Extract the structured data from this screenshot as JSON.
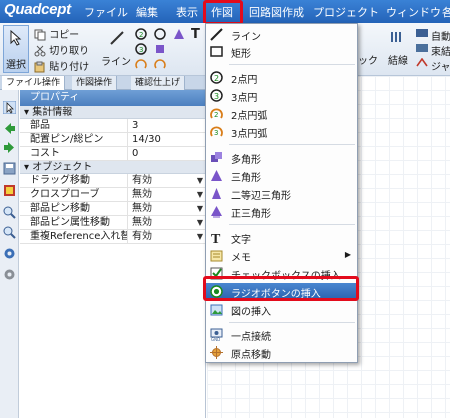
{
  "app": {
    "logo": "Quadcept"
  },
  "menubar": {
    "items": [
      "ファイル",
      "編集",
      "表示",
      "作図",
      "回路図作成",
      "プロジェクト",
      "ウィンドウ",
      "各"
    ],
    "active_index": 3
  },
  "ribbon": {
    "select_label": "選択",
    "copy_label": "コピー",
    "cut_label": "切り取り",
    "paste_label": "貼り付け",
    "line_label": "ライン",
    "right_fragment": "ック",
    "wiring_label": "結線",
    "auto_label": "自動",
    "bundle_label": "束結",
    "jump_label": "ジャ"
  },
  "tabs": [
    {
      "label": "ファイル操作"
    },
    {
      "label": "作図操作"
    },
    {
      "label": "確認仕上げ"
    }
  ],
  "property_panel": {
    "title": "プロパティ",
    "sections": [
      {
        "title": "集計情報",
        "rows": [
          {
            "key": "部品",
            "value": "3"
          },
          {
            "key": "配置ピン/総ピン",
            "value": "14/30"
          },
          {
            "key": "コスト",
            "value": "0"
          }
        ]
      },
      {
        "title": "オブジェクト",
        "rows": [
          {
            "key": "ドラッグ移動",
            "value": "有効"
          },
          {
            "key": "クロスプローブ",
            "value": "無効"
          },
          {
            "key": "部品ピン移動",
            "value": "無効"
          },
          {
            "key": "部品ピン属性移動",
            "value": "無効"
          },
          {
            "key": "重複Reference入れ替え",
            "value": "有効"
          }
        ]
      }
    ]
  },
  "dropdown": {
    "items": [
      {
        "label": "ライン",
        "icon": "line-icon"
      },
      {
        "label": "矩形",
        "icon": "rectangle-icon"
      },
      {
        "label": "2点円",
        "icon": "circle-2pt-icon"
      },
      {
        "label": "3点円",
        "icon": "circle-3pt-icon"
      },
      {
        "label": "2点円弧",
        "icon": "arc-2pt-icon"
      },
      {
        "label": "3点円弧",
        "icon": "arc-3pt-icon"
      },
      {
        "label": "多角形",
        "icon": "polygon-icon"
      },
      {
        "label": "三角形",
        "icon": "triangle-icon"
      },
      {
        "label": "二等辺三角形",
        "icon": "isosceles-triangle-icon"
      },
      {
        "label": "正三角形",
        "icon": "equilateral-triangle-icon"
      },
      {
        "label": "文字",
        "icon": "text-icon"
      },
      {
        "label": "メモ",
        "icon": "memo-icon"
      },
      {
        "label": "チェックボックスの挿入",
        "icon": "checkbox-icon"
      },
      {
        "label": "ラジオボタンの挿入",
        "icon": "radio-button-icon",
        "highlighted": true
      },
      {
        "label": "図の挿入",
        "icon": "picture-icon"
      },
      {
        "label": "一点接続",
        "icon": "single-point-connect-icon"
      },
      {
        "label": "原点移動",
        "icon": "origin-move-icon"
      }
    ]
  },
  "colors": {
    "menubar": "#2b6fc7",
    "highlight_outline": "#e30b1c",
    "menu_selection": "#2f6cb8"
  }
}
